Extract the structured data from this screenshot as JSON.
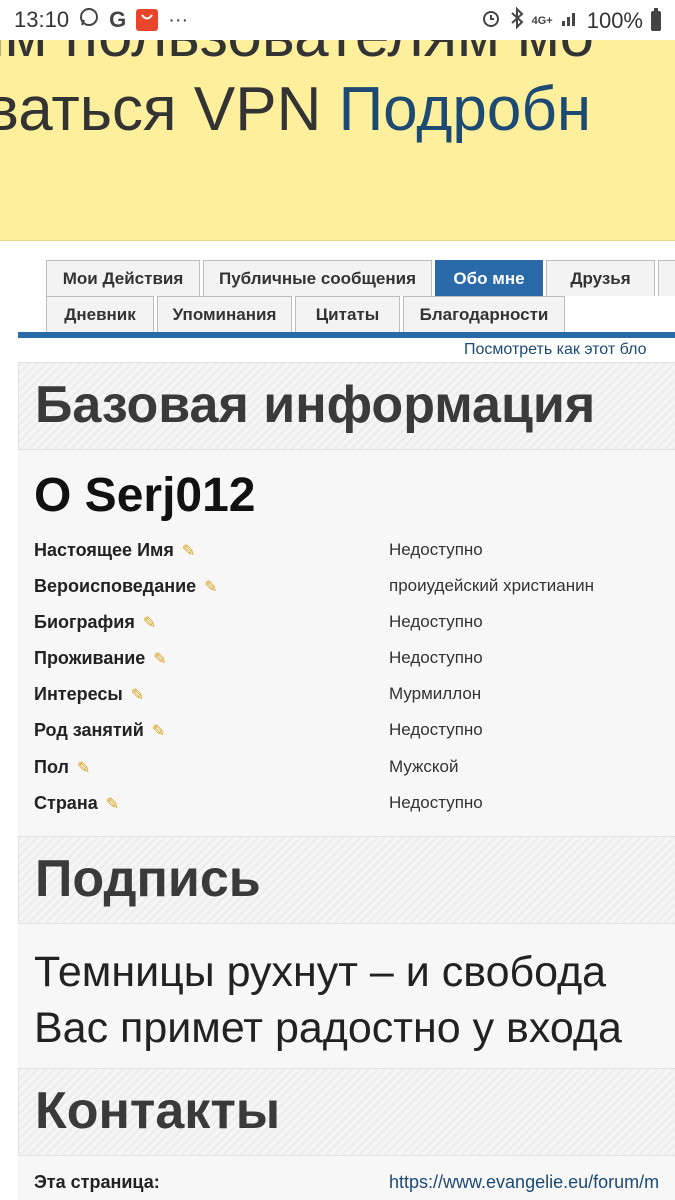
{
  "status_bar": {
    "time": "13:10",
    "left_icons": [
      "whatsapp-icon",
      "google-icon",
      "aliexpress-icon",
      "more-dots-icon"
    ],
    "network": "4G+",
    "battery": "100%"
  },
  "banner": {
    "line1": "им пользователям мо",
    "line2_prefix": "ваться VPN ",
    "line2_link": "Подробн"
  },
  "tabs": {
    "row1": [
      "Мои Действия",
      "Публичные сообщения",
      "Обо мне",
      "Друзья"
    ],
    "row2": [
      "Дневник",
      "Упоминания",
      "Цитаты",
      "Благодарности"
    ],
    "active": "Обо мне"
  },
  "view_link": "Посмотреть как этот бло",
  "basic_info": {
    "heading": "Базовая информация",
    "about_title": "О Serj012",
    "rows": [
      {
        "label": "Настоящее Имя",
        "value": "Недоступно"
      },
      {
        "label": "Вероисповедание",
        "value": "проиудейский христианин"
      },
      {
        "label": "Биография",
        "value": "Недоступно"
      },
      {
        "label": "Проживание",
        "value": "Недоступно"
      },
      {
        "label": "Интересы",
        "value": "Мурмиллон"
      },
      {
        "label": "Род занятий",
        "value": "Недоступно"
      },
      {
        "label": "Пол",
        "value": "Мужской"
      },
      {
        "label": "Страна",
        "value": "Недоступно"
      }
    ]
  },
  "signature": {
    "heading": "Подпись",
    "line1": "Темницы рухнут – и свобода",
    "line2": "Вас примет радостно у входа"
  },
  "contacts": {
    "heading": "Контакты",
    "label": "Эта страница:",
    "value": "https://www.evangelie.eu/forum/m"
  }
}
